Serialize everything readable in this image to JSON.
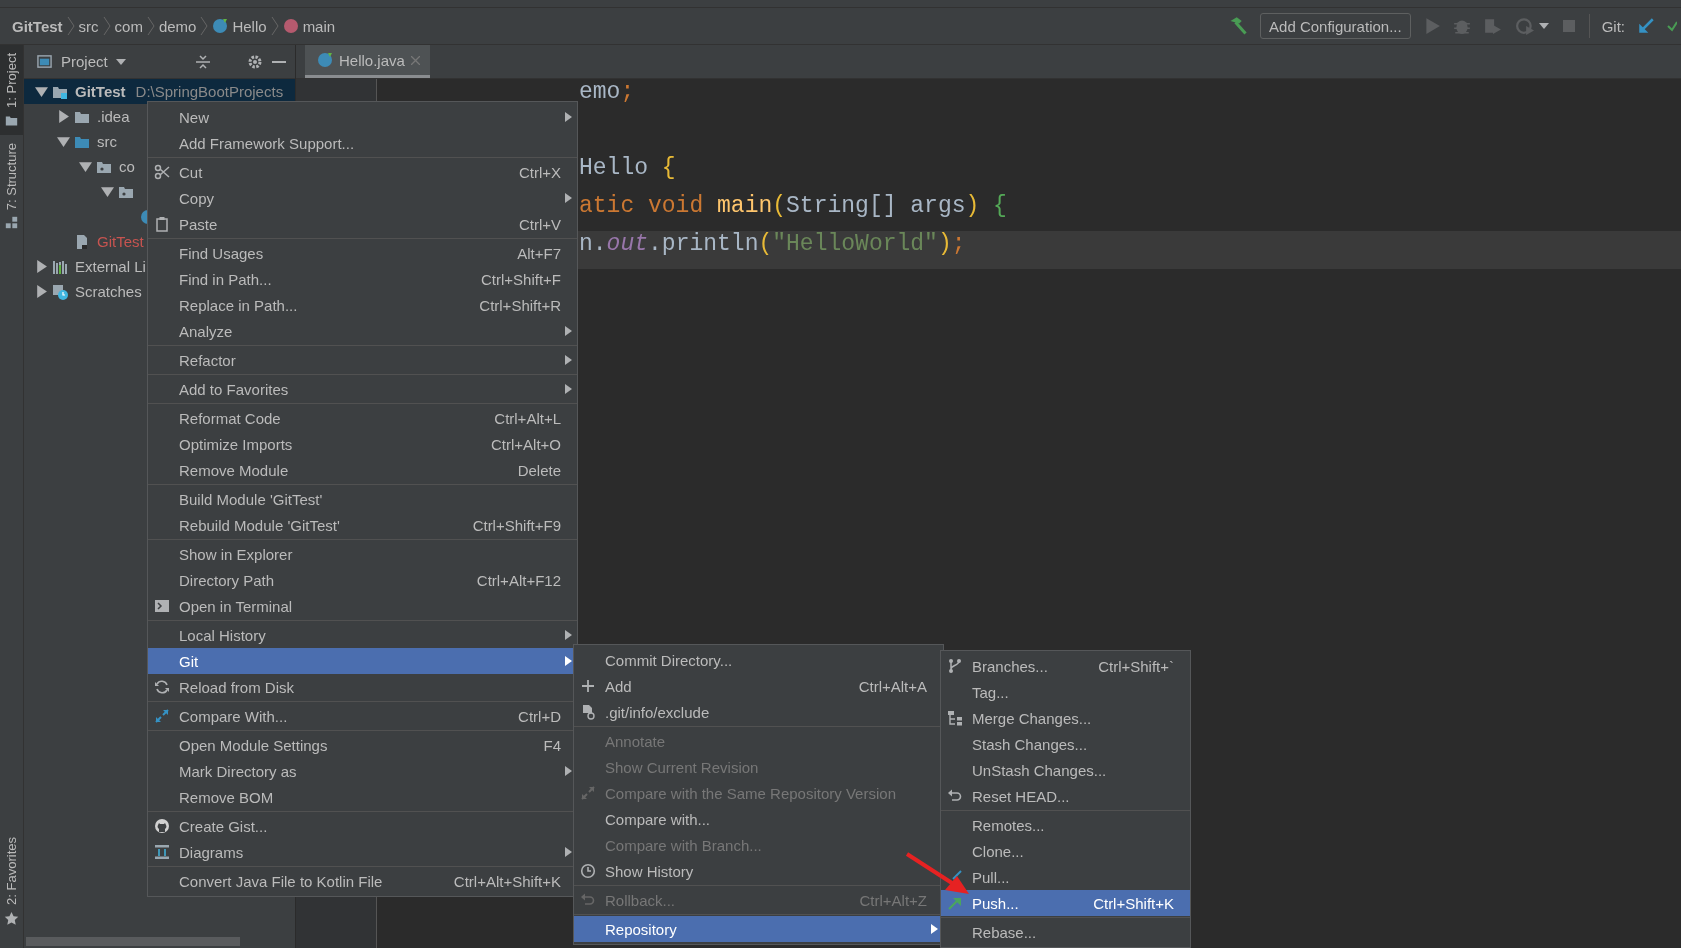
{
  "breadcrumbs": [
    {
      "label": "GitTest",
      "kind": "project"
    },
    {
      "label": "src",
      "kind": "folder"
    },
    {
      "label": "com",
      "kind": "folder"
    },
    {
      "label": "demo",
      "kind": "folder"
    },
    {
      "label": "Hello",
      "kind": "class"
    },
    {
      "label": "main",
      "kind": "method"
    }
  ],
  "toolbar": {
    "run_config": "Add Configuration...",
    "vcs_label": "Git:"
  },
  "side_tabs_top": [
    {
      "label": "1: Project",
      "selected": true,
      "kind": "project"
    },
    {
      "label": "7: Structure",
      "selected": false,
      "kind": "structure"
    }
  ],
  "side_tabs_bottom": [
    {
      "label": "2: Favorites",
      "selected": false,
      "kind": "favorites"
    }
  ],
  "project_panel": {
    "title": "Project",
    "tree": [
      {
        "label": "GitTest",
        "path": "D:\\SpringBootProjects",
        "kind": "module",
        "expanded": true,
        "selected": true,
        "children": [
          {
            "label": ".idea",
            "kind": "folder",
            "expanded": false,
            "selected": false
          },
          {
            "label": "src",
            "kind": "source",
            "expanded": true,
            "selected": false,
            "children": [
              {
                "label": "co",
                "kind": "package",
                "expanded": true,
                "selected": false,
                "children": [
                  {
                    "kind": "package",
                    "expanded": true,
                    "selected": false,
                    "children": [
                      {
                        "kind": "class",
                        "selected": false
                      }
                    ]
                  }
                ]
              }
            ]
          },
          {
            "label": "GitTest",
            "kind": "iml",
            "selected": false,
            "modified": true
          }
        ]
      },
      {
        "label": "External Li",
        "kind": "libraries",
        "expanded": false,
        "selected": false
      },
      {
        "label": "Scratches",
        "kind": "scratches",
        "expanded": false,
        "selected": false
      }
    ]
  },
  "editor": {
    "tabs": [
      {
        "label": "Hello.java",
        "selected": true
      }
    ],
    "lines": [
      {
        "current": false,
        "tokens": [
          {
            "text": "emo",
            "kind": "plain"
          },
          {
            "text": ";",
            "kind": "keyword"
          }
        ]
      },
      {
        "current": false
      },
      {
        "current": false,
        "tokens": [
          {
            "text": "Hello ",
            "kind": "plain"
          },
          {
            "text": "{",
            "kind": "paren"
          }
        ]
      },
      {
        "current": false,
        "tokens": [
          {
            "text": "atic void ",
            "kind": "keyword"
          },
          {
            "text": "main",
            "kind": "method"
          },
          {
            "text": "(",
            "kind": "paren"
          },
          {
            "text": "String[] args",
            "kind": "plain"
          },
          {
            "text": ")",
            "kind": "paren"
          },
          {
            "text": " {",
            "kind": "brace"
          }
        ]
      },
      {
        "current": true,
        "tokens": [
          {
            "text": "n.",
            "kind": "plain"
          },
          {
            "text": "out",
            "kind": "field"
          },
          {
            "text": ".println",
            "kind": "plain"
          },
          {
            "text": "(",
            "kind": "paren"
          },
          {
            "text": "\"HelloWorld\"",
            "kind": "string"
          },
          {
            "text": ")",
            "kind": "paren"
          },
          {
            "text": ";",
            "kind": "keyword"
          }
        ]
      }
    ]
  },
  "context_menu": {
    "groups": [
      {
        "items": [
          {
            "label": "New",
            "kind": "plain",
            "submenu": true,
            "selected": false
          },
          {
            "label": "Add Framework Support...",
            "kind": "plain",
            "selected": false
          }
        ]
      },
      {
        "items": [
          {
            "label": "Cut",
            "shortcut": "Ctrl+X",
            "kind": "cut",
            "selected": false
          },
          {
            "label": "Copy",
            "kind": "plain",
            "submenu": true,
            "selected": false
          },
          {
            "label": "Paste",
            "shortcut": "Ctrl+V",
            "kind": "paste",
            "selected": false
          }
        ]
      },
      {
        "items": [
          {
            "label": "Find Usages",
            "shortcut": "Alt+F7",
            "kind": "plain",
            "selected": false
          },
          {
            "label": "Find in Path...",
            "shortcut": "Ctrl+Shift+F",
            "kind": "plain",
            "selected": false
          },
          {
            "label": "Replace in Path...",
            "shortcut": "Ctrl+Shift+R",
            "kind": "plain",
            "selected": false
          },
          {
            "label": "Analyze",
            "kind": "plain",
            "submenu": true,
            "selected": false
          }
        ]
      },
      {
        "items": [
          {
            "label": "Refactor",
            "kind": "plain",
            "submenu": true,
            "selected": false
          }
        ]
      },
      {
        "items": [
          {
            "label": "Add to Favorites",
            "kind": "plain",
            "submenu": true,
            "selected": false
          }
        ]
      },
      {
        "items": [
          {
            "label": "Reformat Code",
            "shortcut": "Ctrl+Alt+L",
            "kind": "plain",
            "selected": false
          },
          {
            "label": "Optimize Imports",
            "shortcut": "Ctrl+Alt+O",
            "kind": "plain",
            "selected": false
          },
          {
            "label": "Remove Module",
            "shortcut": "Delete",
            "kind": "plain",
            "selected": false
          }
        ]
      },
      {
        "items": [
          {
            "label": "Build Module 'GitTest'",
            "kind": "plain",
            "selected": false
          },
          {
            "label": "Rebuild Module 'GitTest'",
            "shortcut": "Ctrl+Shift+F9",
            "kind": "plain",
            "selected": false
          }
        ]
      },
      {
        "items": [
          {
            "label": "Show in Explorer",
            "kind": "plain",
            "selected": false
          },
          {
            "label": "Directory Path",
            "shortcut": "Ctrl+Alt+F12",
            "kind": "plain",
            "selected": false
          },
          {
            "label": "Open in Terminal",
            "kind": "terminal",
            "selected": false
          }
        ]
      },
      {
        "items": [
          {
            "label": "Local History",
            "kind": "plain",
            "submenu": true,
            "selected": false
          },
          {
            "label": "Git",
            "kind": "plain",
            "submenu": true,
            "selected": true
          },
          {
            "label": "Reload from Disk",
            "kind": "reload",
            "selected": false
          }
        ]
      },
      {
        "items": [
          {
            "label": "Compare With...",
            "shortcut": "Ctrl+D",
            "kind": "compare",
            "selected": false
          }
        ]
      },
      {
        "items": [
          {
            "label": "Open Module Settings",
            "shortcut": "F4",
            "kind": "plain",
            "selected": false
          },
          {
            "label": "Mark Directory as",
            "kind": "plain",
            "submenu": true,
            "selected": false
          },
          {
            "label": "Remove BOM",
            "kind": "plain",
            "selected": false
          }
        ]
      },
      {
        "items": [
          {
            "label": "Create Gist...",
            "kind": "github",
            "selected": false
          },
          {
            "label": "Diagrams",
            "submenu": true,
            "kind": "diagrams",
            "selected": false
          }
        ]
      },
      {
        "items": [
          {
            "label": "Convert Java File to Kotlin File",
            "shortcut": "Ctrl+Alt+Shift+K",
            "kind": "plain",
            "selected": false
          }
        ]
      }
    ]
  },
  "git_menu": {
    "groups": [
      {
        "items": [
          {
            "label": "Commit Directory...",
            "kind": "plain",
            "selected": false
          },
          {
            "label": "Add",
            "shortcut": "Ctrl+Alt+A",
            "kind": "add",
            "selected": false
          },
          {
            "label": ".git/info/exclude",
            "kind": "exclude",
            "selected": false
          }
        ]
      },
      {
        "items": [
          {
            "label": "Annotate",
            "kind": "plain",
            "selected": false,
            "disabled": true
          },
          {
            "label": "Show Current Revision",
            "kind": "plain",
            "selected": false,
            "disabled": true
          },
          {
            "label": "Compare with the Same Repository Version",
            "kind": "compare",
            "selected": false,
            "disabled": true
          },
          {
            "label": "Compare with...",
            "kind": "plain",
            "selected": false
          },
          {
            "label": "Compare with Branch...",
            "kind": "plain",
            "selected": false,
            "disabled": true
          },
          {
            "label": "Show History",
            "kind": "history",
            "selected": false
          }
        ]
      },
      {
        "items": [
          {
            "label": "Rollback...",
            "shortcut": "Ctrl+Alt+Z",
            "kind": "rollback",
            "selected": false,
            "disabled": true
          }
        ]
      },
      {
        "items": [
          {
            "label": "Repository",
            "kind": "plain",
            "submenu": true,
            "selected": true
          }
        ]
      }
    ]
  },
  "repository_menu": {
    "groups": [
      {
        "items": [
          {
            "label": "Branches...",
            "shortcut": "Ctrl+Shift+`",
            "kind": "branches",
            "selected": false
          },
          {
            "label": "Tag...",
            "kind": "plain",
            "selected": false
          },
          {
            "label": "Merge Changes...",
            "kind": "merge",
            "selected": false
          },
          {
            "label": "Stash Changes...",
            "kind": "plain",
            "selected": false
          },
          {
            "label": "UnStash Changes...",
            "kind": "plain",
            "selected": false
          },
          {
            "label": "Reset HEAD...",
            "kind": "rollback",
            "selected": false
          }
        ]
      },
      {
        "items": [
          {
            "label": "Remotes...",
            "kind": "plain",
            "selected": false
          },
          {
            "label": "Clone...",
            "kind": "plain",
            "selected": false
          },
          {
            "label": "Pull...",
            "kind": "pull",
            "selected": false
          },
          {
            "label": "Push...",
            "shortcut": "Ctrl+Shift+K",
            "kind": "push",
            "selected": true
          }
        ]
      },
      {
        "items": [
          {
            "label": "Rebase...",
            "kind": "plain",
            "selected": false
          }
        ]
      }
    ]
  }
}
